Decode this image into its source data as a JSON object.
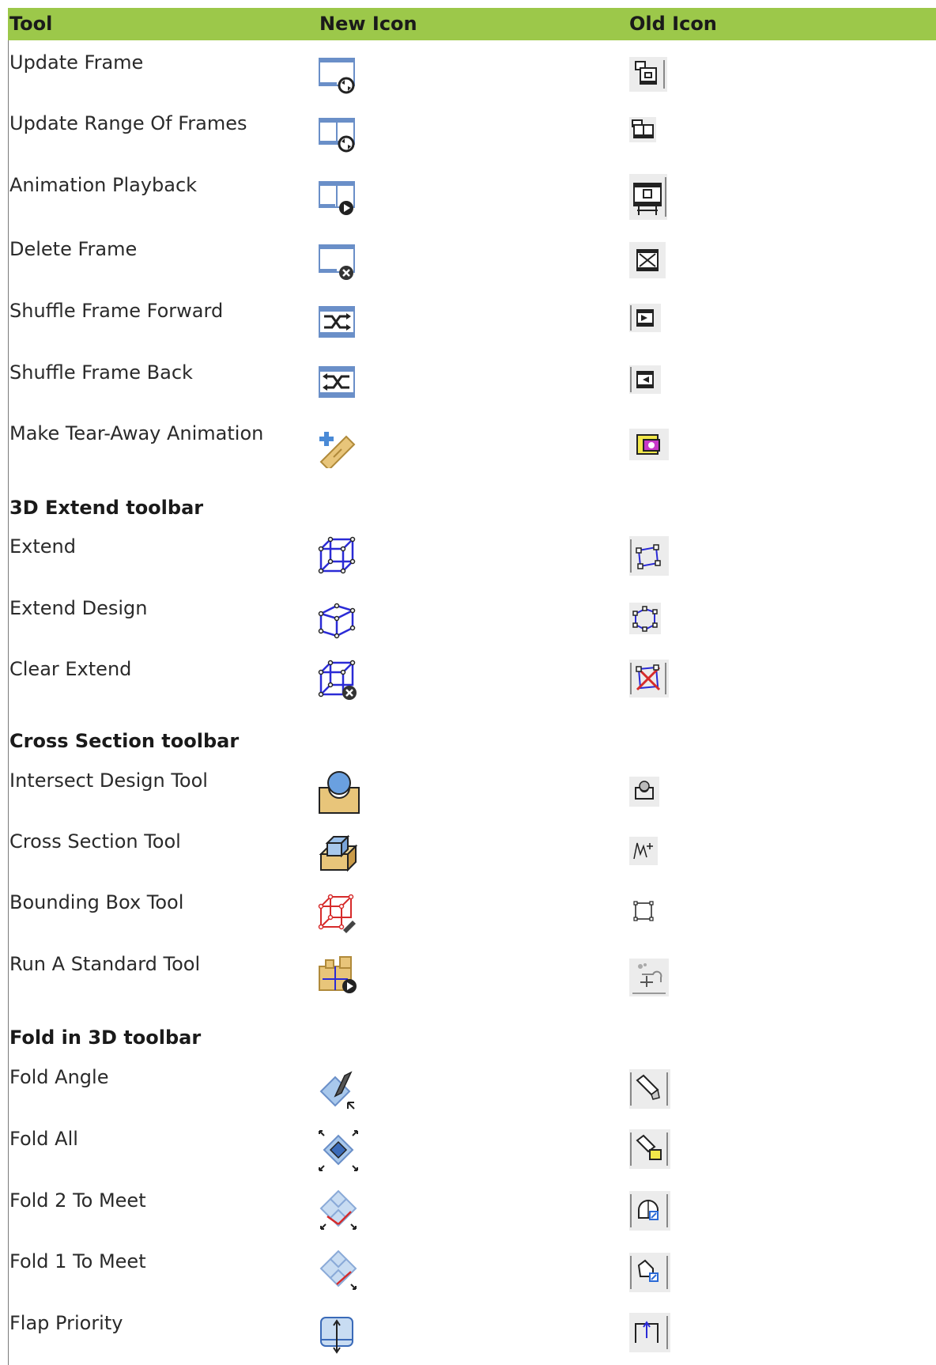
{
  "table": {
    "headers": {
      "tool": "Tool",
      "new_icon": "New Icon",
      "old_icon": "Old Icon"
    },
    "rows": [
      {
        "label": "Update Frame",
        "new_icon": "update-frame-icon",
        "old_icon": "update-frame-old-icon"
      },
      {
        "label": "Update Range Of Frames",
        "new_icon": "update-range-of-frames-icon",
        "old_icon": "update-range-of-frames-old-icon"
      },
      {
        "label": "Animation Playback",
        "new_icon": "animation-playback-icon",
        "old_icon": "animation-playback-old-icon"
      },
      {
        "label": "Delete Frame",
        "new_icon": "delete-frame-icon",
        "old_icon": "delete-frame-old-icon"
      },
      {
        "label": "Shuffle Frame Forward",
        "new_icon": "shuffle-frame-forward-icon",
        "old_icon": "shuffle-frame-forward-old-icon"
      },
      {
        "label": "Shuffle Frame Back",
        "new_icon": "shuffle-frame-back-icon",
        "old_icon": "shuffle-frame-back-old-icon"
      },
      {
        "label": "Make Tear-Away Animation",
        "new_icon": "tear-away-animation-icon",
        "old_icon": "tear-away-animation-old-icon"
      }
    ],
    "sections": [
      {
        "title": "3D Extend toolbar",
        "rows": [
          {
            "label": "Extend",
            "new_icon": "extend-icon",
            "old_icon": "extend-old-icon"
          },
          {
            "label": "Extend Design",
            "new_icon": "extend-design-icon",
            "old_icon": "extend-design-old-icon"
          },
          {
            "label": "Clear Extend",
            "new_icon": "clear-extend-icon",
            "old_icon": "clear-extend-old-icon"
          }
        ]
      },
      {
        "title": "Cross Section toolbar",
        "rows": [
          {
            "label": "Intersect Design Tool",
            "new_icon": "intersect-design-icon",
            "old_icon": "intersect-design-old-icon"
          },
          {
            "label": "Cross Section Tool",
            "new_icon": "cross-section-icon",
            "old_icon": "cross-section-old-icon"
          },
          {
            "label": "Bounding Box Tool",
            "new_icon": "bounding-box-icon",
            "old_icon": "bounding-box-old-icon"
          },
          {
            "label": "Run A Standard Tool",
            "new_icon": "run-standard-tool-icon",
            "old_icon": "run-standard-tool-old-icon"
          }
        ]
      },
      {
        "title": "Fold in 3D toolbar",
        "rows": [
          {
            "label": "Fold Angle",
            "new_icon": "fold-angle-icon",
            "old_icon": "fold-angle-old-icon"
          },
          {
            "label": "Fold All",
            "new_icon": "fold-all-icon",
            "old_icon": "fold-all-old-icon"
          },
          {
            "label": "Fold 2 To Meet",
            "new_icon": "fold-2-to-meet-icon",
            "old_icon": "fold-2-to-meet-old-icon"
          },
          {
            "label": "Fold 1 To Meet",
            "new_icon": "fold-1-to-meet-icon",
            "old_icon": "fold-1-to-meet-old-icon"
          },
          {
            "label": "Flap Priority",
            "new_icon": "flap-priority-icon",
            "old_icon": "flap-priority-old-icon"
          }
        ]
      }
    ]
  },
  "colors": {
    "header_bg": "#9cc84a",
    "icon_blue": "#2b2bd6",
    "icon_red": "#d62b2b",
    "icon_tan": "#e8c57a",
    "icon_light_blue": "#a8c8ec"
  }
}
